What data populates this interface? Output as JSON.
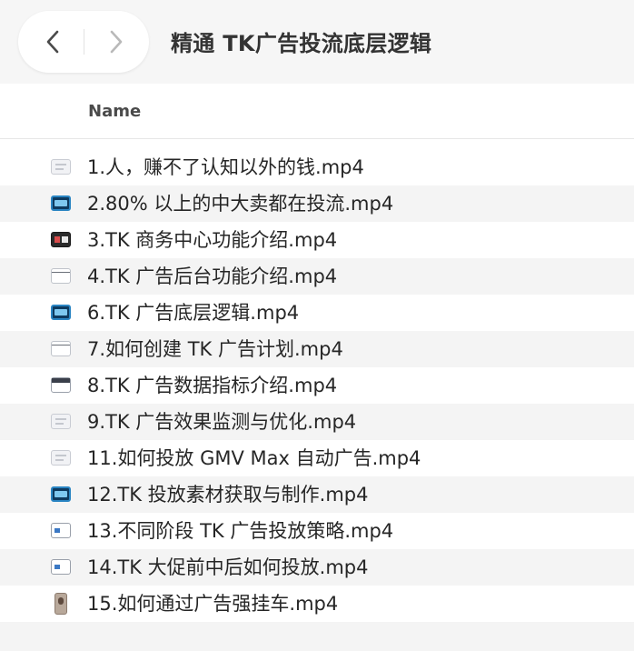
{
  "window": {
    "title": "精通 TK广告投流底层逻辑"
  },
  "nav": {
    "back_icon": "chevron-left-icon",
    "forward_icon": "chevron-right-icon"
  },
  "list_header": {
    "name_label": "Name"
  },
  "files": [
    {
      "name": "1.人，赚不了认知以外的钱.mp4",
      "icon": "doc"
    },
    {
      "name": "2.80% 以上的中大卖都在投流.mp4",
      "icon": "screen"
    },
    {
      "name": "3.TK 商务中心功能介绍.mp4",
      "icon": "dark"
    },
    {
      "name": "4.TK 广告后台功能介绍.mp4",
      "icon": "blank"
    },
    {
      "name": "6.TK 广告底层逻辑.mp4",
      "icon": "screen"
    },
    {
      "name": "7.如何创建 TK 广告计划.mp4",
      "icon": "blank"
    },
    {
      "name": "8.TK 广告数据指标介绍.mp4",
      "icon": "stripe"
    },
    {
      "name": "9.TK 广告效果监测与优化.mp4",
      "icon": "doc"
    },
    {
      "name": "11.如何投放 GMV Max 自动广告.mp4",
      "icon": "doc"
    },
    {
      "name": "12.TK 投放素材获取与制作.mp4",
      "icon": "screen"
    },
    {
      "name": "13.不同阶段 TK 广告投放策略.mp4",
      "icon": "card"
    },
    {
      "name": "14.TK 大促前中后如何投放.mp4",
      "icon": "card"
    },
    {
      "name": "15.如何通过广告强挂车.mp4",
      "icon": "photo"
    }
  ]
}
